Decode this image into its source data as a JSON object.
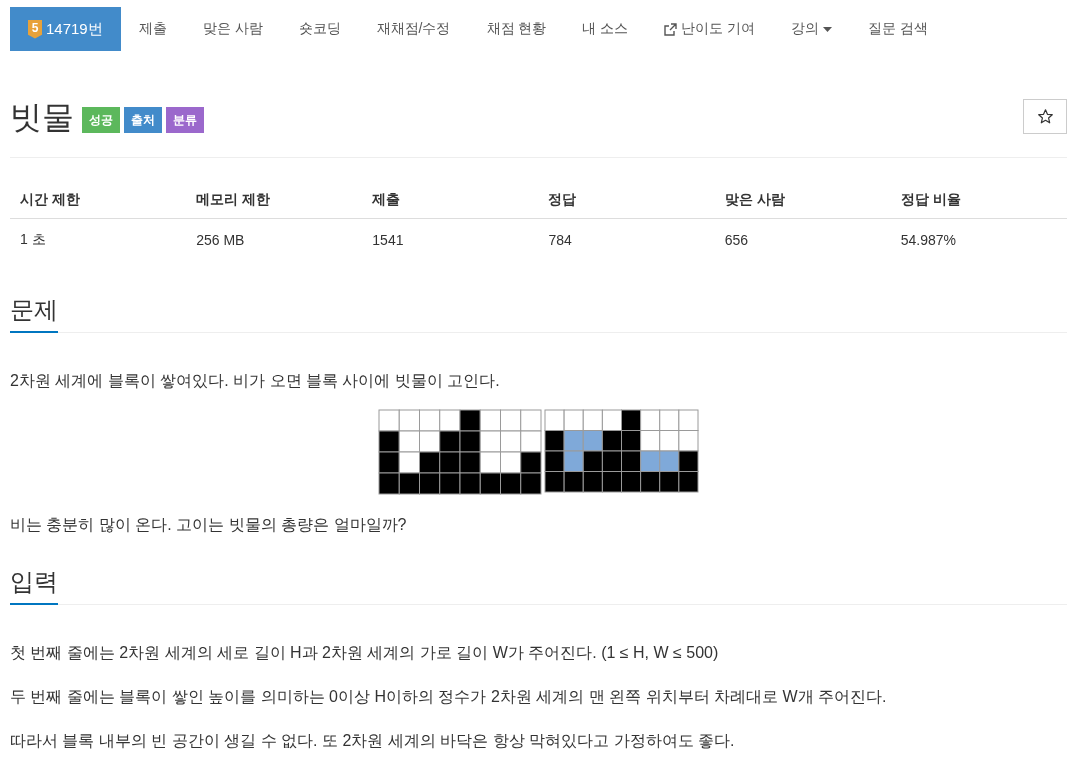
{
  "nav": {
    "items": [
      {
        "kind": "problem",
        "badge": "5",
        "label": "14719번",
        "selected": true
      },
      {
        "kind": "link",
        "label": "제출",
        "selected": false
      },
      {
        "kind": "link",
        "label": "맞은 사람",
        "selected": false
      },
      {
        "kind": "link",
        "label": "숏코딩",
        "selected": false
      },
      {
        "kind": "link",
        "label": "재채점/수정",
        "selected": false
      },
      {
        "kind": "link",
        "label": "채점 현황",
        "selected": false
      },
      {
        "kind": "link",
        "label": "내 소스",
        "selected": false
      },
      {
        "kind": "external",
        "label": "난이도 기여",
        "selected": false
      },
      {
        "kind": "dropdown",
        "label": "강의",
        "selected": false
      },
      {
        "kind": "link",
        "label": "질문 검색",
        "selected": false
      }
    ]
  },
  "problem": {
    "title": "빗물",
    "labels": [
      {
        "text": "성공",
        "color": "#5cb85c"
      },
      {
        "text": "출처",
        "color": "#428bca"
      },
      {
        "text": "분류",
        "color": "#9b68cc"
      }
    ],
    "favorite": {
      "starred": false
    }
  },
  "stats": {
    "columns": [
      "시간 제한",
      "메모리 제한",
      "제출",
      "정답",
      "맞은 사람",
      "정답 비율"
    ],
    "rows": [
      [
        "1 초",
        "256 MB",
        "1541",
        "784",
        "656",
        "54.987%"
      ]
    ]
  },
  "sections": [
    {
      "heading": "문제",
      "content": [
        {
          "kind": "text",
          "text": "2차원 세계에 블록이 쌓여있다. 비가 오면 블록 사이에 빗물이 고인다."
        },
        {
          "kind": "figure"
        },
        {
          "kind": "text",
          "text": "비는 충분히 많이 온다. 고이는 빗물의 총량은 얼마일까?"
        }
      ]
    },
    {
      "heading": "입력",
      "content": [
        {
          "kind": "text",
          "text": "첫 번째 줄에는 2차원 세계의 세로 길이 H과 2차원 세계의 가로 길이 W가 주어진다. (1 ≤ H, W ≤ 500)"
        },
        {
          "kind": "text",
          "text": "두 번째 줄에는 블록이 쌓인 높이를 의미하는 0이상 H이하의 정수가 2차원 세계의 맨 왼쪽 위치부터 차례대로 W개 주어진다."
        },
        {
          "kind": "text",
          "text": "따라서 블록 내부의 빈 공간이 생길 수 없다. 또 2차원 세계의 바닥은 항상 막혀있다고 가정하여도 좋다."
        }
      ]
    }
  ]
}
